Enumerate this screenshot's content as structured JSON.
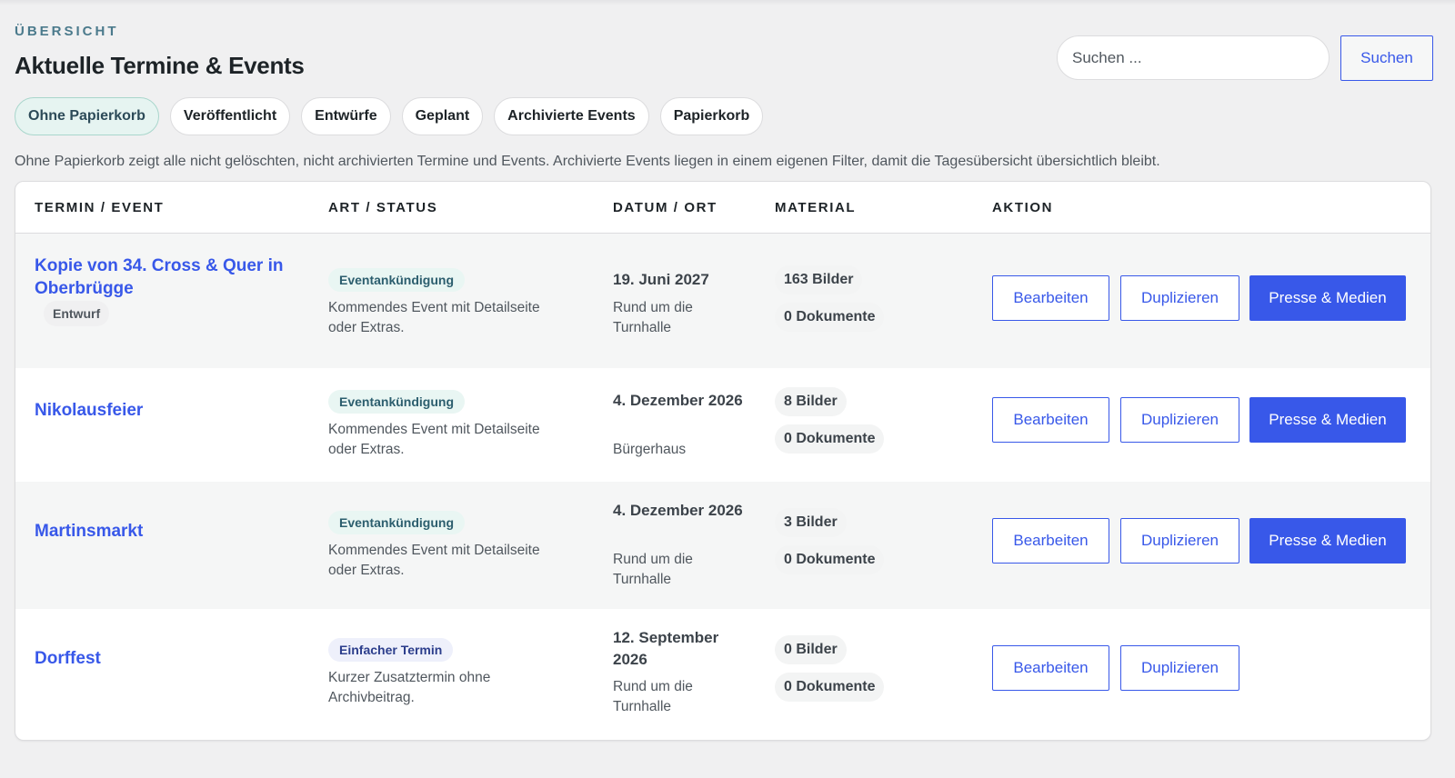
{
  "header": {
    "eyebrow": "ÜBERSICHT",
    "title": "Aktuelle Termine & Events"
  },
  "search": {
    "placeholder": "Suchen ...",
    "button_label": "Suchen"
  },
  "filters": [
    {
      "label": "Ohne Papierkorb",
      "active": true
    },
    {
      "label": "Veröffentlicht",
      "active": false
    },
    {
      "label": "Entwürfe",
      "active": false
    },
    {
      "label": "Geplant",
      "active": false
    },
    {
      "label": "Archivierte Events",
      "active": false
    },
    {
      "label": "Papierkorb",
      "active": false
    }
  ],
  "description": "Ohne Papierkorb zeigt alle nicht gelöschten, nicht archivierten Termine und Events. Archivierte Events liegen in einem eigenen Filter, damit die Tagesübersicht übersichtlich bleibt.",
  "table": {
    "headers": [
      "TERMIN / EVENT",
      "ART / STATUS",
      "DATUM / ORT",
      "MATERIAL",
      "AKTION"
    ],
    "actions": {
      "edit": "Bearbeiten",
      "duplicate": "Duplizieren",
      "press": "Presse & Medien"
    },
    "rows": [
      {
        "title": "Kopie von 34. Cross & Quer in Oberbrügge",
        "badge": "Entwurf",
        "type": "Eventankündigung",
        "type_desc": "Kommendes Event mit Detailseite oder Extras.",
        "date": "19. Juni 2027",
        "place": "Rund um die Turnhalle",
        "images": "163 Bilder",
        "documents": "0 Dokumente"
      },
      {
        "title": "Nikolausfeier",
        "type": "Eventankündigung",
        "type_desc": "Kommendes Event mit Detailseite oder Extras.",
        "date": "4. Dezember 2026",
        "place": "Bürgerhaus",
        "images": "8 Bilder",
        "documents": "0 Dokumente"
      },
      {
        "title": "Martinsmarkt",
        "type": "Eventankündigung",
        "type_desc": "Kommendes Event mit Detailseite oder Extras.",
        "date": "4. Dezember 2026",
        "place": "Rund um die Turnhalle",
        "images": "3 Bilder",
        "documents": "0 Dokumente"
      },
      {
        "title": "Dorffest",
        "type": "Einfacher Termin",
        "type_desc": "Kurzer Zusatztermin ohne Archivbeitrag.",
        "date": "12. September 2026",
        "place": "Rund um die Turnhalle",
        "images": "0 Bilder",
        "documents": "0 Dokumente"
      }
    ]
  },
  "colors": {
    "accent": "#3858e9",
    "background": "#f0f0f1",
    "eyebrow": "#4b7a8c",
    "active_filter_bg": "#e6f4f1"
  }
}
